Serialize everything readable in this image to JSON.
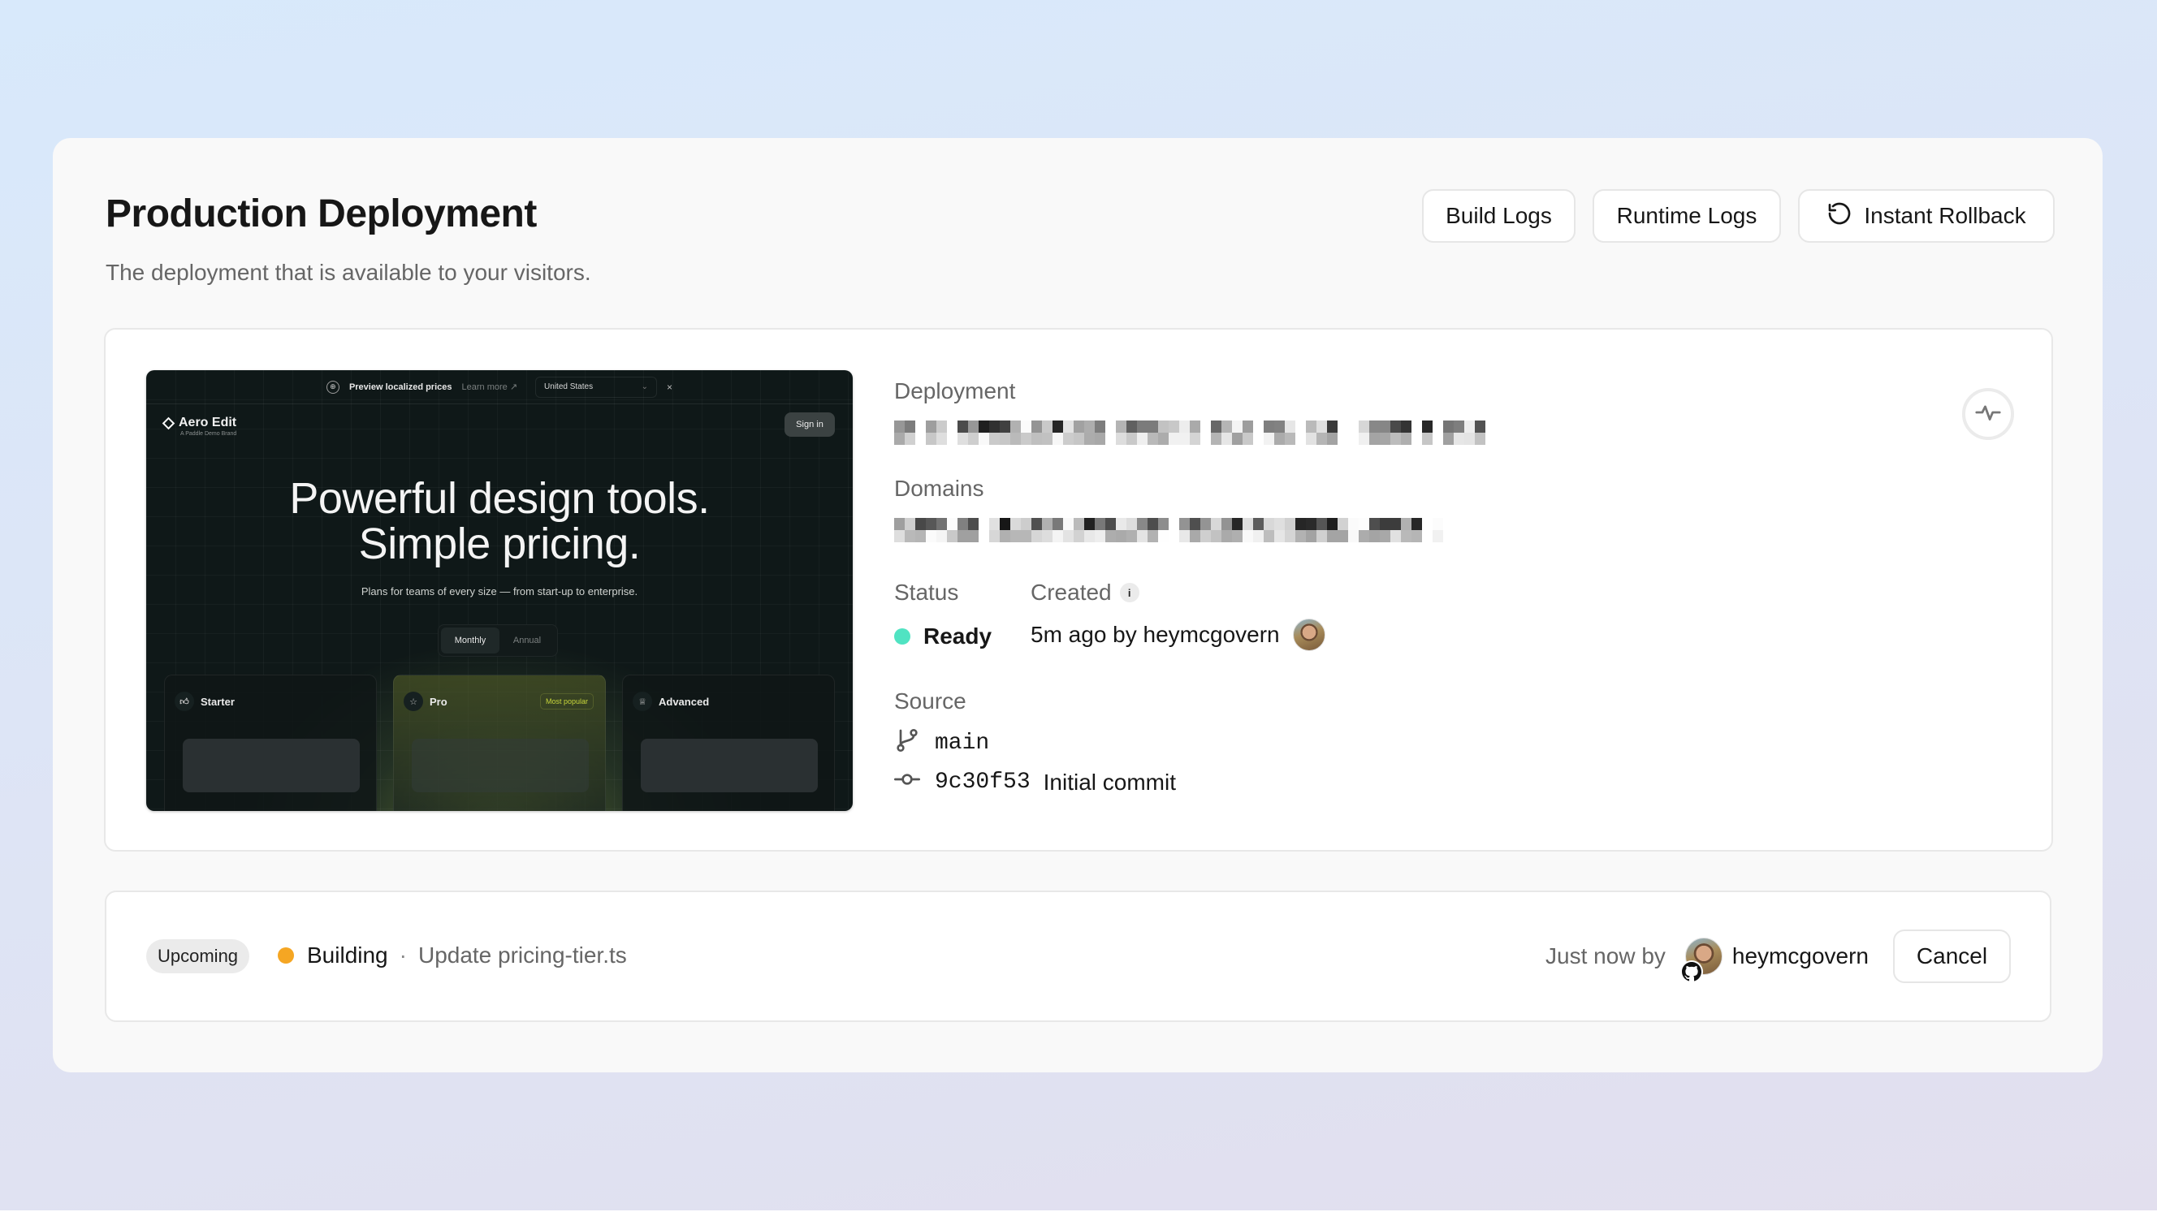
{
  "header": {
    "title": "Production Deployment",
    "subtitle": "The deployment that is available to your visitors.",
    "buttons": {
      "build_logs": "Build Logs",
      "runtime_logs": "Runtime Logs",
      "instant_rollback": "Instant Rollback",
      "instant_rollback_icon": "rotate-ccw-icon"
    }
  },
  "preview": {
    "banner": {
      "text": "Preview localized prices",
      "link": "Learn more ↗",
      "country": "United States",
      "close": "×"
    },
    "brand": {
      "name": "Aero Edit",
      "tagline": "A Paddle Demo Brand"
    },
    "sign_in": "Sign in",
    "hero_line1": "Powerful design tools.",
    "hero_line2": "Simple pricing.",
    "hero_sub": "Plans for teams of every size — from start-up to enterprise.",
    "toggle": {
      "monthly": "Monthly",
      "annual": "Annual",
      "selected": "Monthly"
    },
    "plans": [
      {
        "name": "Starter",
        "icon": "thumbs-up-icon"
      },
      {
        "name": "Pro",
        "icon": "star-icon",
        "badge": "Most popular"
      },
      {
        "name": "Advanced",
        "icon": "trophy-icon"
      }
    ]
  },
  "details": {
    "deployment_label": "Deployment",
    "deployment_value_redacted": true,
    "domains_label": "Domains",
    "domains_value_redacted": true,
    "status_label": "Status",
    "status_value": "Ready",
    "status_color": "#50e3c2",
    "created_label": "Created",
    "created_info_icon": "i",
    "created_value": "5m ago by heymcgovern",
    "source_label": "Source",
    "branch": "main",
    "commit_hash": "9c30f53",
    "commit_message": "Initial commit",
    "activity_icon": "activity-icon"
  },
  "upcoming": {
    "badge": "Upcoming",
    "status": "Building",
    "status_color": "#f5a623",
    "separator": "·",
    "commit_message": "Update pricing-tier.ts",
    "time_text": "Just now by",
    "user": "heymcgovern",
    "cancel_label": "Cancel"
  }
}
